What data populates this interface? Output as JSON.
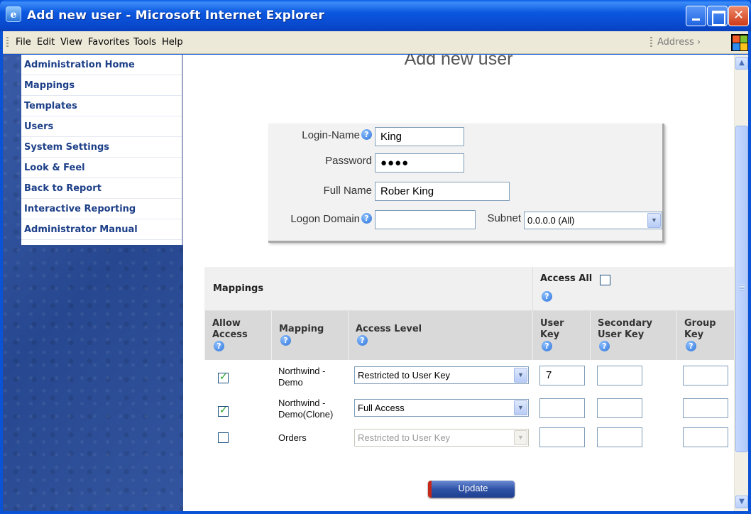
{
  "window": {
    "title": "Add new user - Microsoft Internet Explorer"
  },
  "menubar": {
    "items": [
      "File",
      "Edit",
      "View",
      "Favorites",
      "Tools",
      "Help"
    ],
    "address_label": "Address ›"
  },
  "sidebar": {
    "items": [
      {
        "label": "Administration Home"
      },
      {
        "label": "Mappings"
      },
      {
        "label": "Templates"
      },
      {
        "label": "Users"
      },
      {
        "label": "System Settings"
      },
      {
        "label": "Look & Feel"
      },
      {
        "label": "Back to Report"
      },
      {
        "label": "Interactive Reporting"
      },
      {
        "label": "Administrator Manual"
      }
    ]
  },
  "page": {
    "heading": "Add new user"
  },
  "form": {
    "login_name_label": "Login-Name",
    "login_name_value": "King",
    "password_label": "Password",
    "password_value": "●●●●",
    "full_name_label": "Full Name",
    "full_name_value": "Rober King",
    "logon_domain_label": "Logon Domain",
    "logon_domain_value": "",
    "subnet_label": "Subnet",
    "subnet_value": "0.0.0.0 (All)"
  },
  "mappings": {
    "title": "Mappings",
    "access_all_label": "Access All",
    "access_all_checked": false,
    "columns": {
      "allow_access": "Allow Access",
      "mapping": "Mapping",
      "access_level": "Access Level",
      "user_key": "User Key",
      "secondary_user_key": "Secondary User Key",
      "group_key": "Group Key"
    },
    "rows": [
      {
        "allowed": true,
        "mapping": "Northwind - Demo",
        "access_level": "Restricted to User Key",
        "user_key": "7",
        "secondary_user_key": "",
        "group_key": "",
        "enabled": true
      },
      {
        "allowed": true,
        "mapping": "Northwind - Demo(Clone)",
        "access_level": "Full Access",
        "user_key": "",
        "secondary_user_key": "",
        "group_key": "",
        "enabled": true
      },
      {
        "allowed": false,
        "mapping": "Orders",
        "access_level": "Restricted to User Key",
        "user_key": "",
        "secondary_user_key": "",
        "group_key": "",
        "enabled": false
      }
    ]
  },
  "actions": {
    "update_label": "Update"
  },
  "colors": {
    "titlebar": "#0b58e0",
    "sidebar_bg": "#2c4e9a",
    "nav_link": "#1d3f88",
    "update_button": "#2e52a6"
  }
}
